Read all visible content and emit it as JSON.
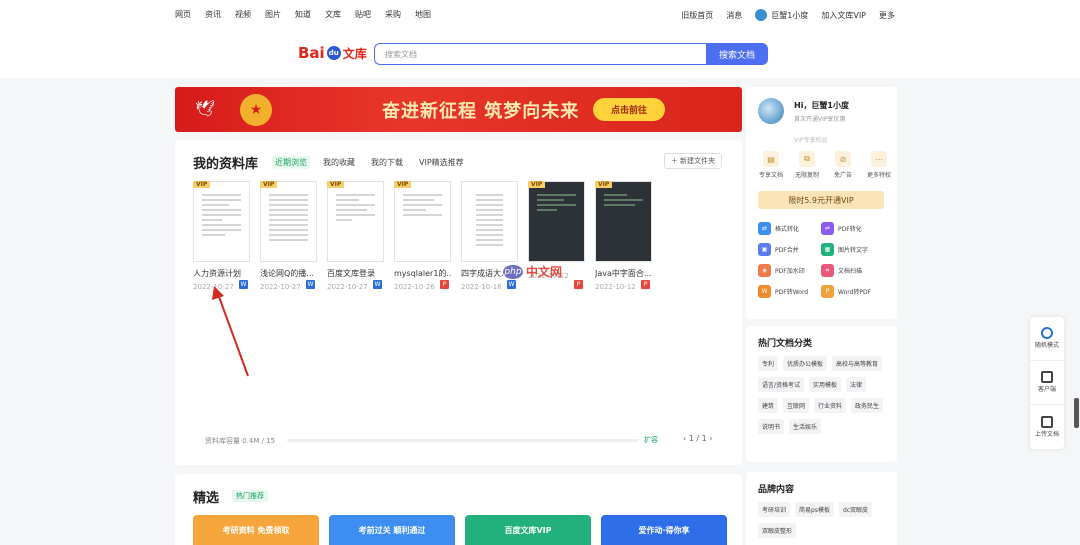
{
  "topnav": {
    "left": [
      "网页",
      "资讯",
      "视频",
      "图片",
      "知道",
      "文库",
      "贴吧",
      "采购",
      "地图"
    ],
    "old_version": "旧版首页",
    "messages": "消息",
    "username": "巨蟹1小度",
    "join_vip": "加入文库VIP",
    "more": "更多"
  },
  "header": {
    "logo_bai": "Bai",
    "logo_du": "du",
    "logo_wenku": "文库",
    "search_placeholder": "搜索文档",
    "search_button": "搜索文档"
  },
  "banner": {
    "slogan": "奋进新征程 筑梦向未来",
    "go_button": "点击前往"
  },
  "library": {
    "title": "我的资料库",
    "tabs": [
      "近期浏览",
      "我的收藏",
      "我的下载",
      "VIP精选推荐"
    ],
    "new_folder": "新建文件夹",
    "docs": [
      {
        "name": "人力资源计划",
        "date": "2022-10-27",
        "type": "W"
      },
      {
        "name": "浅论网Q的播...",
        "date": "2022-10-27",
        "type": "W"
      },
      {
        "name": "百度文库登录",
        "date": "2022-10-27",
        "type": "W"
      },
      {
        "name": "mysqlaler1的...",
        "date": "2022-10-26",
        "type": "P"
      },
      {
        "name": "四字成语大...",
        "date": "2022-10-18",
        "type": "W"
      },
      {
        "name": "",
        "date": "2022-10-12",
        "type": "P"
      },
      {
        "name": "Java中字面合...",
        "date": "2022-10-12",
        "type": "P"
      }
    ],
    "storage_label": "资料库容量 0.4M / 15",
    "storage_end": "扩容",
    "pager": "1 / 1"
  },
  "watermark": {
    "php": "php",
    "site": "中文网"
  },
  "picks": {
    "title": "精选",
    "tag": "热门推荐",
    "cards": [
      {
        "label": "考研资料 免费领取",
        "color": "#f6a53c"
      },
      {
        "label": "考前过关 顺利通过",
        "color": "#3d8ef0"
      },
      {
        "label": "百度文库VIP",
        "color": "#22b07d"
      },
      {
        "label": "爱作动·得你享",
        "color": "#2e6ee8"
      }
    ]
  },
  "user": {
    "greeting": "Hi，巨蟹1小度",
    "subtitle": "首次开通VIP享优惠",
    "level": "VIP专享权益",
    "perks": [
      "专享文档",
      "无限复制",
      "免广告",
      "更多特权"
    ],
    "vip_button": "限时5.9元开通VIP",
    "tools": [
      {
        "label": "格式转化",
        "color": "#3d8ef0"
      },
      {
        "label": "PDF转化",
        "color": "#8a5cf0"
      },
      {
        "label": "PDF合并",
        "color": "#5b7cf0"
      },
      {
        "label": "图片转文字",
        "color": "#22b07d"
      },
      {
        "label": "PDF加水印",
        "color": "#f07a4c"
      },
      {
        "label": "文档扫描",
        "color": "#e8587a"
      },
      {
        "label": "PDF转Word",
        "color": "#f08a2c"
      },
      {
        "label": "Word转PDF",
        "color": "#f0a23c"
      }
    ]
  },
  "hot": {
    "title": "热门文档分类",
    "chips": [
      "专利",
      "优质办公模板",
      "高校与高等教育",
      "语言/资格考试",
      "实用模板",
      "法律",
      "建筑",
      "互联网",
      "行业资料",
      "政务民生",
      "说明书",
      "生活娱乐"
    ]
  },
  "brand": {
    "title": "品牌内容",
    "chips": [
      "考研培训",
      "简易ps模板",
      "dc双眼皮",
      "双眼皮整形"
    ]
  },
  "rail": {
    "items": [
      "随机模式",
      "客户端",
      "上传文档"
    ]
  }
}
